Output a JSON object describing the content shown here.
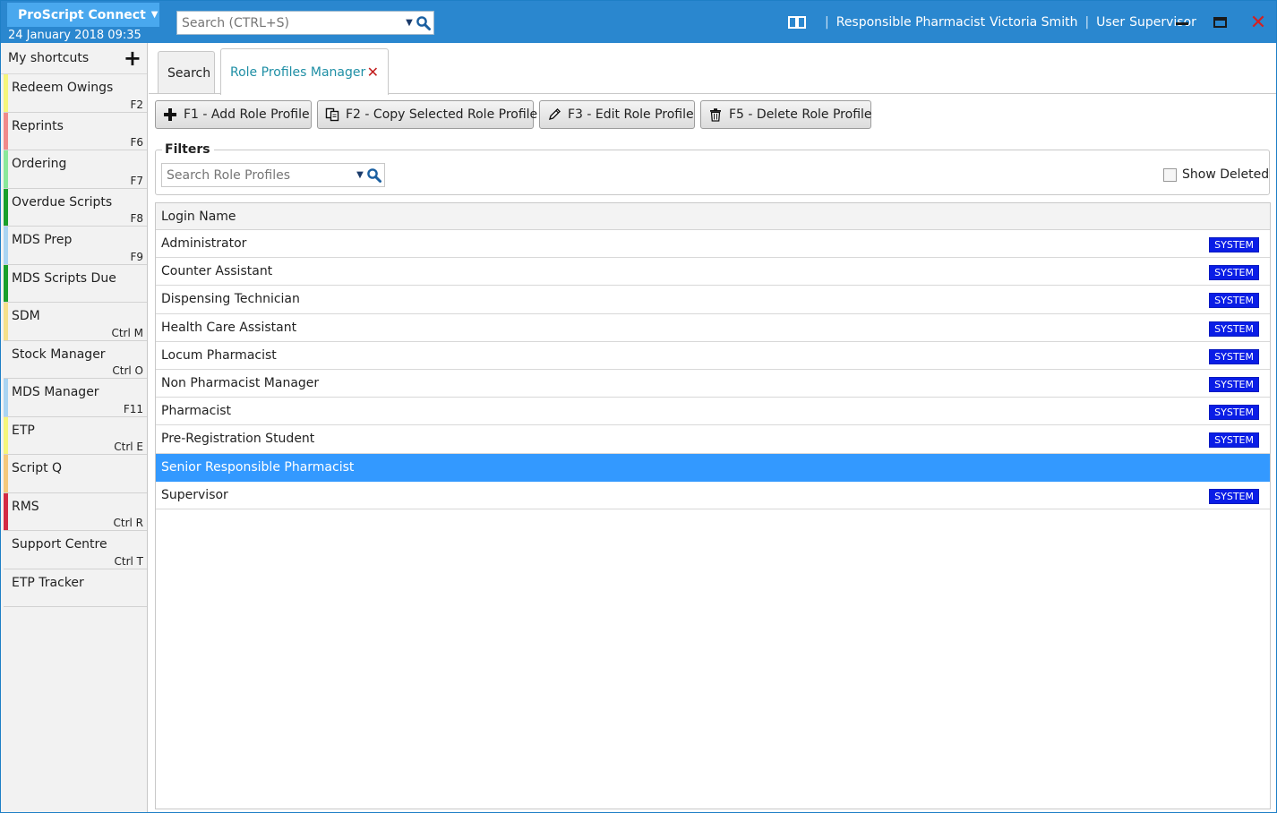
{
  "app": {
    "name": "ProScript Connect",
    "datetime": "24 January 2018 09:35",
    "search_placeholder": "Search (CTRL+S)"
  },
  "user_bar": {
    "responsible_label": "Responsible Pharmacist",
    "responsible_name": "Victoria Smith",
    "user_label": "User",
    "user_name": "Supervisor"
  },
  "sidebar": {
    "header": "My shortcuts",
    "items": [
      {
        "label": "Redeem Owings",
        "key": "F2",
        "color": "#f5f57a"
      },
      {
        "label": "Reprints",
        "key": "F6",
        "color": "#f08a8a"
      },
      {
        "label": "Ordering",
        "key": "F7",
        "color": "#8ae89a"
      },
      {
        "label": "Overdue Scripts",
        "key": "F8",
        "color": "#1aa02a"
      },
      {
        "label": "MDS Prep",
        "key": "F9",
        "color": "#a9d4f2"
      },
      {
        "label": "MDS Scripts Due",
        "key": "",
        "color": "#1aa02a"
      },
      {
        "label": "SDM",
        "key": "Ctrl M",
        "color": "#f5e08a"
      },
      {
        "label": "Stock Manager",
        "key": "Ctrl O",
        "color": ""
      },
      {
        "label": "MDS Manager",
        "key": "F11",
        "color": "#a9d4f2"
      },
      {
        "label": "ETP",
        "key": "Ctrl E",
        "color": "#f5f57a"
      },
      {
        "label": "Script Q",
        "key": "",
        "color": "#f5c87a"
      },
      {
        "label": "RMS",
        "key": "Ctrl R",
        "color": "#d42a44"
      },
      {
        "label": "Support Centre",
        "key": "Ctrl T",
        "color": ""
      },
      {
        "label": "ETP Tracker",
        "key": "",
        "color": ""
      }
    ]
  },
  "tabs": {
    "search": "Search",
    "role_profiles": "Role Profiles Manager"
  },
  "toolbar": {
    "add": "F1 - Add Role Profile",
    "copy": "F2 - Copy Selected Role Profile",
    "edit": "F3 - Edit Role Profile",
    "delete": "F5 - Delete Role Profile"
  },
  "filters": {
    "title": "Filters",
    "search_placeholder": "Search Role Profiles",
    "show_deleted": "Show Deleted",
    "show_deleted_checked": false
  },
  "grid": {
    "column_header": "Login Name",
    "rows": [
      {
        "name": "Administrator",
        "badge": "SYSTEM",
        "selected": false
      },
      {
        "name": "Counter Assistant",
        "badge": "SYSTEM",
        "selected": false
      },
      {
        "name": "Dispensing Technician",
        "badge": "SYSTEM",
        "selected": false
      },
      {
        "name": "Health Care Assistant",
        "badge": "SYSTEM",
        "selected": false
      },
      {
        "name": "Locum Pharmacist",
        "badge": "SYSTEM",
        "selected": false
      },
      {
        "name": "Non Pharmacist Manager",
        "badge": "SYSTEM",
        "selected": false
      },
      {
        "name": "Pharmacist",
        "badge": "SYSTEM",
        "selected": false
      },
      {
        "name": "Pre-Registration Student",
        "badge": "SYSTEM",
        "selected": false
      },
      {
        "name": "Senior Responsible Pharmacist",
        "badge": "",
        "selected": true
      },
      {
        "name": "Supervisor",
        "badge": "SYSTEM",
        "selected": false
      }
    ]
  },
  "colors": {
    "titlebar": "#2a87cf",
    "app_button": "#49a8ee",
    "selected_row": "#3399ff",
    "badge": "#0a1de6",
    "active_tab_text": "#1f8fa5",
    "close_red": "#d42121"
  }
}
